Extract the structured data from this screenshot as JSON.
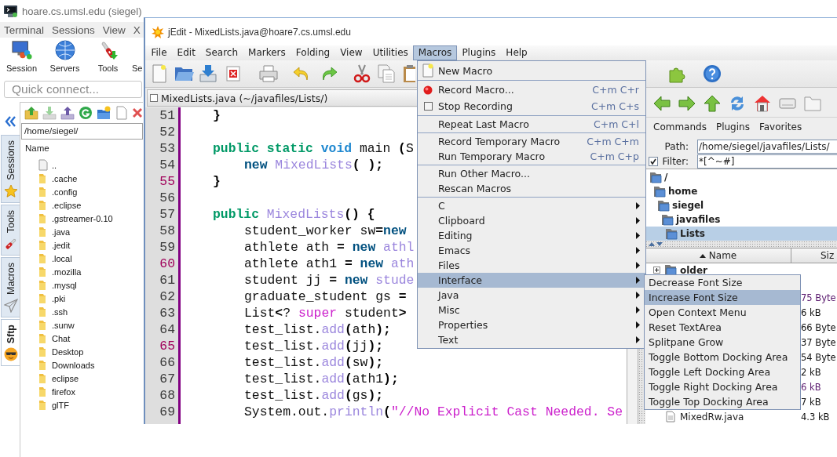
{
  "mobaxterm": {
    "title": "hoare.cs.umsl.edu (siegel)",
    "menu": [
      "Terminal",
      "Sessions",
      "View",
      "X"
    ],
    "toolbar": [
      "Session",
      "Servers",
      "Tools",
      "Se"
    ],
    "quick_connect": {
      "placeholder": "Quick connect..."
    },
    "side_tabs": [
      {
        "label": "Sessions",
        "selected": false
      },
      {
        "label": "Tools",
        "selected": false
      },
      {
        "label": "Macros",
        "selected": false
      },
      {
        "label": "Sftp",
        "selected": true
      }
    ],
    "sftp": {
      "path": "/home/siegel/",
      "column": "Name",
      "files": [
        {
          "kind": "parent",
          "name": ".."
        },
        {
          "kind": "folder",
          "name": ".cache"
        },
        {
          "kind": "folder",
          "name": ".config"
        },
        {
          "kind": "folder",
          "name": ".eclipse"
        },
        {
          "kind": "folder",
          "name": ".gstreamer-0.10"
        },
        {
          "kind": "folder",
          "name": ".java"
        },
        {
          "kind": "folder",
          "name": ".jedit"
        },
        {
          "kind": "folder",
          "name": ".local"
        },
        {
          "kind": "folder",
          "name": ".mozilla"
        },
        {
          "kind": "folder",
          "name": ".mysql"
        },
        {
          "kind": "folder",
          "name": ".pki"
        },
        {
          "kind": "folder",
          "name": ".ssh"
        },
        {
          "kind": "folder",
          "name": ".sunw"
        },
        {
          "kind": "folder",
          "name": "Chat"
        },
        {
          "kind": "folder",
          "name": "Desktop"
        },
        {
          "kind": "folder",
          "name": "Downloads"
        },
        {
          "kind": "folder",
          "name": "eclipse"
        },
        {
          "kind": "folder",
          "name": "firefox"
        },
        {
          "kind": "folder",
          "name": "glTF"
        }
      ]
    }
  },
  "jedit": {
    "title": "jEdit - MixedLists.java@hoare7.cs.umsl.edu",
    "menu": [
      {
        "label": "File",
        "selected": false
      },
      {
        "label": "Edit",
        "selected": false
      },
      {
        "label": "Search",
        "selected": false
      },
      {
        "label": "Markers",
        "selected": false
      },
      {
        "label": "Folding",
        "selected": false
      },
      {
        "label": "View",
        "selected": false
      },
      {
        "label": "Utilities",
        "selected": false
      },
      {
        "label": "Macros",
        "selected": true
      },
      {
        "label": "Plugins",
        "selected": false
      },
      {
        "label": "Help",
        "selected": false
      }
    ],
    "buffer": "MixedLists.java (~/javafiles/Lists/)",
    "code": [
      {
        "number": "51",
        "highlighted": false,
        "tokens": [
          {
            "kind": "operator",
            "text": "}"
          }
        ]
      },
      {
        "number": "52",
        "highlighted": false
      },
      {
        "number": "53",
        "highlighted": false,
        "tokens": [
          {
            "kind": "modifier",
            "text": "public static "
          },
          {
            "kind": "type",
            "text": "void"
          },
          {
            "kind": "plain",
            "text": " main "
          },
          {
            "kind": "operator",
            "text": "("
          },
          {
            "kind": "plain",
            "text": "S"
          }
        ],
        "children": [
          {
            "number": "54",
            "highlighted": false,
            "tokens": [
              {
                "kind": "keyword",
                "text": "new "
              },
              {
                "kind": "function",
                "text": "MixedLists"
              },
              {
                "kind": "operator",
                "text": "( );"
              }
            ]
          }
        ]
      },
      {
        "number": "55",
        "highlighted": true,
        "tokens": [
          {
            "kind": "operator",
            "text": "}"
          }
        ]
      },
      {
        "number": "56",
        "highlighted": false
      },
      {
        "number": "57",
        "highlighted": false,
        "tokens": [
          {
            "kind": "modifier",
            "text": "public "
          },
          {
            "kind": "function",
            "text": "MixedLists"
          },
          {
            "kind": "operator",
            "text": "() {"
          }
        ],
        "children": [
          {
            "number": "58",
            "highlighted": false,
            "tokens": [
              {
                "kind": "plain",
                "text": "student_worker sw"
              },
              {
                "kind": "operator",
                "text": "="
              },
              {
                "kind": "keyword",
                "text": "new"
              }
            ]
          },
          {
            "number": "59",
            "highlighted": false,
            "tokens": [
              {
                "kind": "plain",
                "text": "athlete ath "
              },
              {
                "kind": "operator",
                "text": "= "
              },
              {
                "kind": "keyword",
                "text": "new "
              },
              {
                "kind": "function",
                "text": "athl"
              }
            ]
          },
          {
            "number": "60",
            "highlighted": true,
            "tokens": [
              {
                "kind": "plain",
                "text": "athlete ath1 "
              },
              {
                "kind": "operator",
                "text": "= "
              },
              {
                "kind": "keyword",
                "text": "new "
              },
              {
                "kind": "function",
                "text": "ath"
              }
            ]
          },
          {
            "number": "61",
            "highlighted": false,
            "tokens": [
              {
                "kind": "plain",
                "text": "student jj "
              },
              {
                "kind": "operator",
                "text": "= "
              },
              {
                "kind": "keyword",
                "text": "new "
              },
              {
                "kind": "function",
                "text": "stude"
              }
            ]
          },
          {
            "number": "62",
            "highlighted": false,
            "tokens": [
              {
                "kind": "plain",
                "text": "graduate_student gs "
              },
              {
                "kind": "operator",
                "text": "="
              }
            ]
          },
          {
            "number": "63",
            "highlighted": false,
            "tokens": [
              {
                "kind": "plain",
                "text": "List"
              },
              {
                "kind": "operator",
                "text": "<"
              },
              {
                "kind": "plain",
                "text": "? "
              },
              {
                "kind": "literal",
                "text": "super"
              },
              {
                "kind": "plain",
                "text": " student"
              },
              {
                "kind": "operator",
                "text": ">"
              }
            ]
          },
          {
            "number": "64",
            "highlighted": false,
            "tokens": [
              {
                "kind": "plain",
                "text": "test_list."
              },
              {
                "kind": "function",
                "text": "add"
              },
              {
                "kind": "operator",
                "text": "("
              },
              {
                "kind": "plain",
                "text": "ath"
              },
              {
                "kind": "operator",
                "text": ");"
              }
            ]
          },
          {
            "number": "65",
            "highlighted": true,
            "tokens": [
              {
                "kind": "plain",
                "text": "test_list."
              },
              {
                "kind": "function",
                "text": "add"
              },
              {
                "kind": "operator",
                "text": "("
              },
              {
                "kind": "plain",
                "text": "jj"
              },
              {
                "kind": "operator",
                "text": ");"
              }
            ]
          },
          {
            "number": "66",
            "highlighted": false,
            "tokens": [
              {
                "kind": "plain",
                "text": "test_list."
              },
              {
                "kind": "function",
                "text": "add"
              },
              {
                "kind": "operator",
                "text": "("
              },
              {
                "kind": "plain",
                "text": "sw"
              },
              {
                "kind": "operator",
                "text": ");"
              }
            ]
          },
          {
            "number": "67",
            "highlighted": false,
            "tokens": [
              {
                "kind": "plain",
                "text": "test_list."
              },
              {
                "kind": "function",
                "text": "add"
              },
              {
                "kind": "operator",
                "text": "("
              },
              {
                "kind": "plain",
                "text": "ath1"
              },
              {
                "kind": "operator",
                "text": ");"
              }
            ]
          },
          {
            "number": "68",
            "highlighted": false,
            "tokens": [
              {
                "kind": "plain",
                "text": "test_list."
              },
              {
                "kind": "function",
                "text": "add"
              },
              {
                "kind": "operator",
                "text": "("
              },
              {
                "kind": "plain",
                "text": "gs"
              },
              {
                "kind": "operator",
                "text": ");"
              }
            ]
          },
          {
            "number": "69",
            "highlighted": false,
            "tokens": [
              {
                "kind": "plain",
                "text": "System.out."
              },
              {
                "kind": "function",
                "text": "println"
              },
              {
                "kind": "operator",
                "text": "("
              },
              {
                "kind": "literal",
                "text": "\"//No Explicit Cast Needed. Se"
              }
            ]
          }
        ]
      }
    ],
    "browser": {
      "menus": [
        "Commands",
        "Plugins",
        "Favorites"
      ],
      "path": {
        "label": "Path:",
        "value": "/home/siegel/javafiles/Lists/"
      },
      "filter": {
        "label": "Filter:",
        "checked": true,
        "value": "*[^~#]"
      },
      "tree": [
        {
          "name": "/",
          "selected": false,
          "children": [
            {
              "name": "home",
              "selected": false,
              "children": [
                {
                  "name": "siegel",
                  "selected": false,
                  "children": [
                    {
                      "name": "javafiles",
                      "selected": false,
                      "children": [
                        {
                          "name": "Lists",
                          "selected": true
                        }
                      ]
                    }
                  ]
                }
              ]
            }
          ]
        }
      ],
      "columns": [
        "Name",
        "Siz"
      ],
      "rows": [
        {
          "kind": "folder",
          "name": "older",
          "expanded": false
        },
        {
          "size": "75 Byte",
          "open": true
        },
        {
          "size": "6 kB",
          "open": false
        },
        {
          "size": "66 Byte",
          "open": false
        },
        {
          "size": "37 Byte",
          "open": false
        },
        {
          "size": "54 Byte",
          "open": false
        },
        {
          "size": "2 kB",
          "open": false
        },
        {
          "size": "6 kB",
          "open": true
        },
        {
          "size": "7 kB",
          "open": false
        },
        {
          "kind": "file",
          "name": "MixedRw.java",
          "size": "4.3 kB",
          "open": false
        }
      ]
    },
    "macros_menu": {
      "groups": [
        [
          {
            "kind": "new",
            "label": "New Macro",
            "selected": false
          }
        ],
        [
          {
            "kind": "record",
            "label": "Record Macro...",
            "shortcut": "C+m C+r",
            "selected": false
          },
          {
            "kind": "stop",
            "label": "Stop Recording",
            "shortcut": "C+m C+s",
            "selected": false
          }
        ],
        [
          {
            "kind": "command",
            "label": "Repeat Last Macro",
            "shortcut": "C+m C+l",
            "selected": false
          }
        ],
        [
          {
            "kind": "command",
            "label": "Record Temporary Macro",
            "shortcut": "C+m C+m",
            "selected": false
          },
          {
            "kind": "command",
            "label": "Run Temporary Macro",
            "shortcut": "C+m C+p",
            "selected": false
          }
        ],
        [
          {
            "kind": "command",
            "label": "Run Other Macro...",
            "selected": false
          },
          {
            "kind": "command",
            "label": "Rescan Macros",
            "selected": false
          }
        ],
        [
          {
            "kind": "submenu",
            "label": "C",
            "selected": false
          },
          {
            "kind": "submenu",
            "label": "Clipboard",
            "selected": false
          },
          {
            "kind": "submenu",
            "label": "Editing",
            "selected": false
          },
          {
            "kind": "submenu",
            "label": "Emacs",
            "selected": false
          },
          {
            "kind": "submenu",
            "label": "Files",
            "selected": false
          },
          {
            "kind": "submenu",
            "label": "Interface",
            "selected": true
          },
          {
            "kind": "submenu",
            "label": "Java",
            "selected": false
          },
          {
            "kind": "submenu",
            "label": "Misc",
            "selected": false
          },
          {
            "kind": "submenu",
            "label": "Properties",
            "selected": false
          },
          {
            "kind": "submenu",
            "label": "Text",
            "selected": false
          }
        ]
      ]
    },
    "interface_menu": [
      {
        "label": "Decrease Font Size",
        "selected": false
      },
      {
        "label": "Increase Font Size",
        "selected": true
      },
      {
        "label": "Open Context Menu",
        "selected": false
      },
      {
        "label": "Reset TextArea",
        "selected": false
      },
      {
        "label": "Splitpane Grow",
        "selected": false
      },
      {
        "label": "Toggle Bottom Docking Area",
        "selected": false
      },
      {
        "label": "Toggle Left Docking Area",
        "selected": false
      },
      {
        "label": "Toggle Right Docking Area",
        "selected": false
      },
      {
        "label": "Toggle Top Docking Area",
        "selected": false
      }
    ]
  }
}
